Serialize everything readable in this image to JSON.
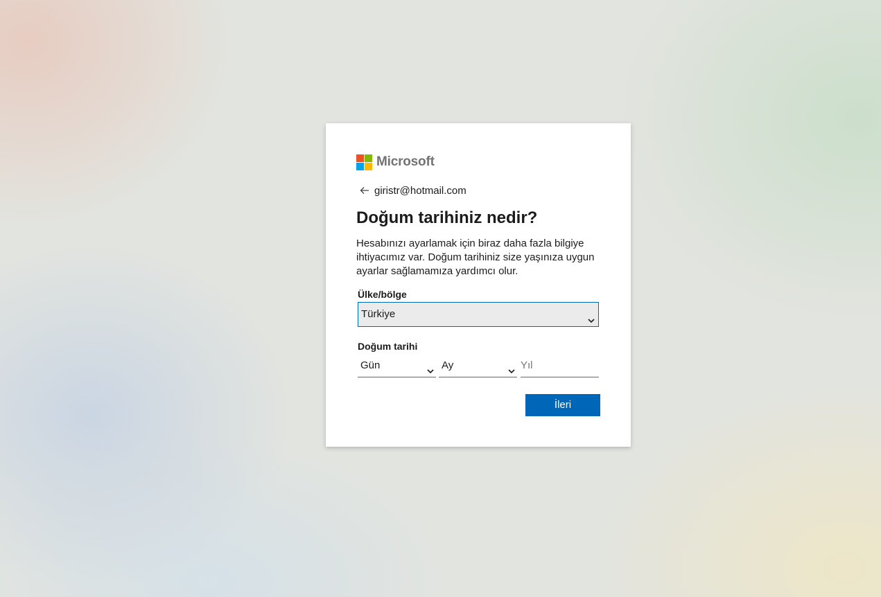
{
  "brand": {
    "name": "Microsoft",
    "colors": [
      "#f25022",
      "#7fba00",
      "#00a4ef",
      "#ffb900"
    ]
  },
  "identity": {
    "email": "giristr@hotmail.com",
    "back_icon": "arrow-left-icon"
  },
  "page": {
    "title": "Doğum tarihiniz nedir?",
    "description": "Hesabınızı ayarlamak için biraz daha fazla bilgiye ihtiyacımız var. Doğum tarihiniz size yaşınıza uygun ayarlar sağlamamıza yardımcı olur."
  },
  "country": {
    "label": "Ülke/bölge",
    "value": "Türkiye"
  },
  "birthdate": {
    "label": "Doğum tarihi",
    "day_value": "Gün",
    "month_value": "Ay",
    "year_placeholder": "Yıl"
  },
  "actions": {
    "next_label": "İleri"
  },
  "colors": {
    "accent": "#0067b8",
    "logo_text": "#737373"
  }
}
